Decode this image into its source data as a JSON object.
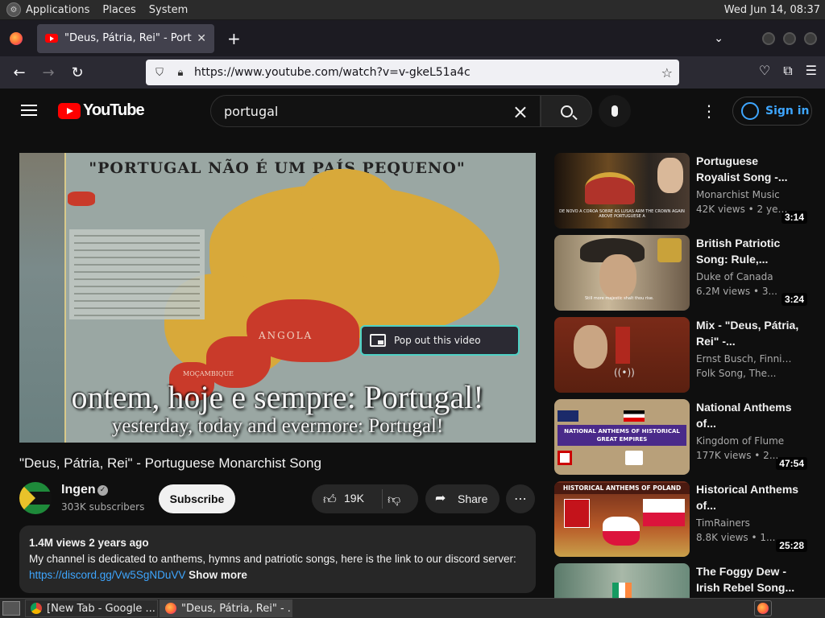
{
  "gnome_panel": {
    "menus": [
      "Applications",
      "Places",
      "System"
    ],
    "clock": "Wed Jun 14, 08:37"
  },
  "browser": {
    "tab_title": "\"Deus, Pátria, Rei\" - Portuguese Monarchist Song",
    "url": "https://www.youtube.com/watch?v=v-gkeL51a4c"
  },
  "youtube": {
    "logo_text": "YouTube",
    "search_value": "portugal",
    "signin_label": "Sign in",
    "video": {
      "poster_title": "\"PORTUGAL NÃO É UM PAÍS PEQUENO\"",
      "map_label_angola": "ANGOLA",
      "map_label_mozambique": "MOÇAMBIQUE",
      "subtitle_line1": "ontem, hoje e sempre: Portugal!",
      "subtitle_line2": "yesterday, today and evermore: Portugal!",
      "pip_label": "Pop out this video",
      "title": "\"Deus, Pátria, Rei\" - Portuguese Monarchist Song",
      "channel_name": "Ingen",
      "subscribers": "303K subscribers",
      "subscribe_label": "Subscribe",
      "likes": "19K",
      "share_label": "Share",
      "description": {
        "stats": "1.4M views  2 years ago",
        "text": "My channel is dedicated to anthems, hymns and patriotic songs, here is the link to our discord server: ",
        "link": "https://discord.gg/Vw5SgNDuVV",
        "show_more": "Show more"
      }
    },
    "recommendations": [
      {
        "title": "Portuguese Royalist Song -...",
        "channel": "Monarchist Music",
        "meta": "42K views • 2 year...",
        "duration": "3:14",
        "thumb_caption": "DE NOVO A COROA SOBRE AS LUSAS ARM THE CROWN AGAIN ABOVE PORTUGUESE A"
      },
      {
        "title": "British Patriotic Song: Rule,...",
        "channel": "Duke of Canada",
        "meta": "6.2M views • 3...",
        "duration": "3:24",
        "thumb_caption": "Still more majestic shalt thou rise."
      },
      {
        "title": "Mix - \"Deus, Pátria, Rei\" -...",
        "channel": "Ernst Busch, Finnish",
        "meta": "Folk Song, The...",
        "duration": "",
        "thumb_caption": ""
      },
      {
        "title": "National Anthems of...",
        "channel": "Kingdom of Flume",
        "meta": "177K views • 2...",
        "duration": "47:54",
        "thumb_caption": "NATIONAL ANTHEMS OF HISTORICAL GREAT EMPIRES"
      },
      {
        "title": "Historical Anthems of...",
        "channel": "TimRainers",
        "meta": "8.8K views • 1...",
        "duration": "25:28",
        "thumb_caption": "HISTORICAL ANTHEMS OF POLAND"
      },
      {
        "title": "The Foggy Dew - Irish Rebel Song...",
        "channel": "",
        "meta": "",
        "duration": "",
        "thumb_caption": ""
      }
    ]
  },
  "taskbar": {
    "tasks": [
      "[New Tab - Google ...",
      "\"Deus, Pátria, Rei\" - ..."
    ]
  }
}
